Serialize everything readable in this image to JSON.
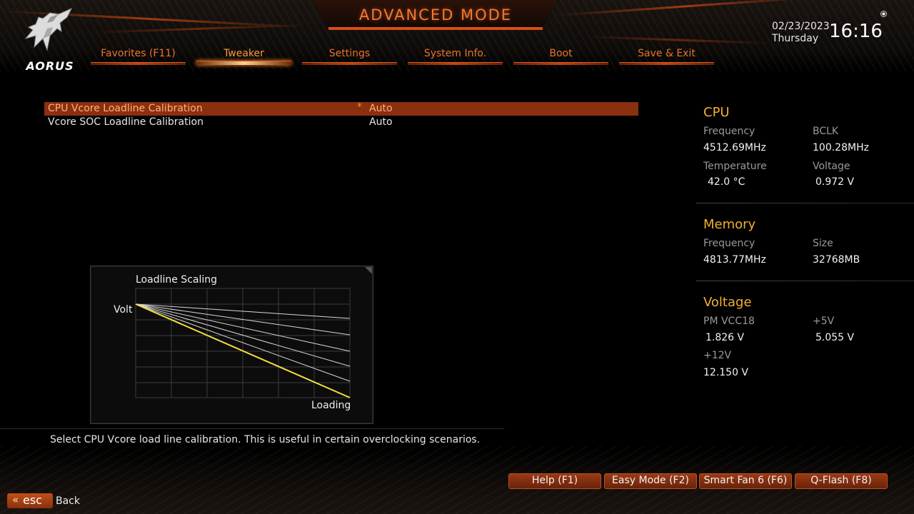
{
  "header": {
    "title": "ADVANCED MODE",
    "brand": "AORUS",
    "date": "02/23/2023",
    "day": "Thursday",
    "time": "16:16"
  },
  "tabs": [
    {
      "label": "Favorites (F11)",
      "active": false
    },
    {
      "label": "Tweaker",
      "active": true
    },
    {
      "label": "Settings",
      "active": false
    },
    {
      "label": "System Info.",
      "active": false
    },
    {
      "label": "Boot",
      "active": false
    },
    {
      "label": "Save & Exit",
      "active": false
    }
  ],
  "options": [
    {
      "label": "CPU Vcore Loadline Calibration",
      "value": "Auto",
      "selected": true,
      "marker": "*"
    },
    {
      "label": "Vcore SOC Loadline Calibration",
      "value": "Auto",
      "selected": false,
      "marker": ""
    }
  ],
  "graph": {
    "title": "Loadline Scaling",
    "y_label": "Volt",
    "x_label": "Loading"
  },
  "description": "Select CPU Vcore load line calibration. This is useful in certain overclocking scenarios.",
  "cpu": {
    "title": "CPU",
    "frequency_label": "Frequency",
    "frequency_value": "4512.69MHz",
    "bclk_label": "BCLK",
    "bclk_value": "100.28MHz",
    "temperature_label": "Temperature",
    "temperature_value": "42.0 °C",
    "voltage_label": "Voltage",
    "voltage_value": "0.972 V"
  },
  "memory": {
    "title": "Memory",
    "frequency_label": "Frequency",
    "frequency_value": "4813.77MHz",
    "size_label": "Size",
    "size_value": "32768MB"
  },
  "voltage": {
    "title": "Voltage",
    "pmvcc18_label": "PM VCC18",
    "pmvcc18_value": "1.826 V",
    "p5v_label": "+5V",
    "p5v_value": "5.055 V",
    "p12v_label": "+12V",
    "p12v_value": "12.150 V"
  },
  "footer": {
    "buttons": [
      "Help (F1)",
      "Easy Mode (F2)",
      "Smart Fan 6 (F6)",
      "Q-Flash (F8)"
    ],
    "esc_label": "esc",
    "back_label": "Back"
  },
  "colors": {
    "accent": "#e8732f",
    "highlight_row": "#8a2f10",
    "section_title": "#f0b030",
    "curve_selected": "#f2e040"
  },
  "icons": [
    "aorus-eagle-logo",
    "settings-gear-icon",
    "asterisk-changed-icon",
    "double-chevron-left-icon"
  ]
}
